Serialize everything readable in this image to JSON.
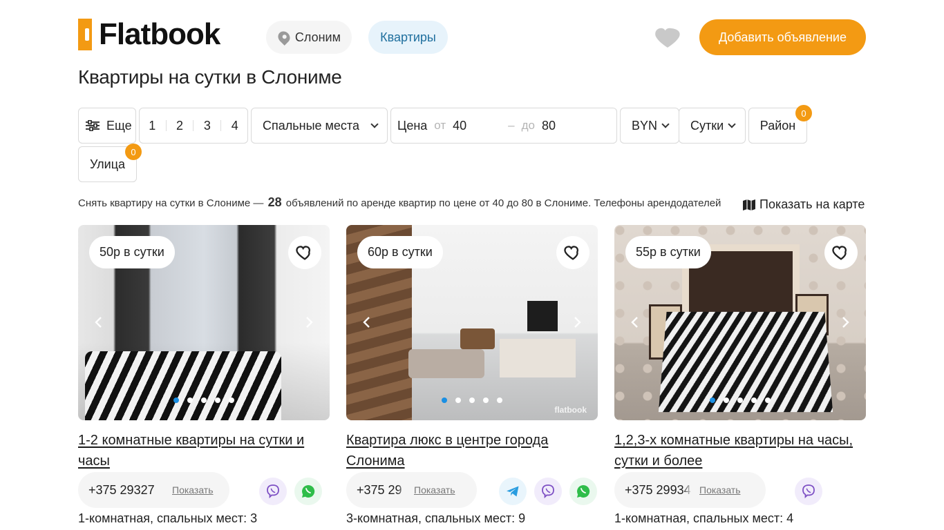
{
  "header": {
    "logo_text": "Flatbook",
    "city": "Слоним",
    "category": "Квартиры",
    "add_button": "Добавить объявление"
  },
  "page_title": "Квартиры на сутки в Слониме",
  "filters": {
    "more_label": "Еще",
    "rooms": [
      "1",
      "2",
      "3",
      "4"
    ],
    "beds_label": "Спальные места",
    "price_label": "Цена",
    "price_from_label": "от",
    "price_from_value": "40",
    "price_dash": "–",
    "price_to_label": "до",
    "price_to_value": "80",
    "currency": "BYN",
    "period": "Сутки",
    "district_label": "Район",
    "district_count": "0",
    "street_label": "Улица",
    "street_count": "0"
  },
  "summary": {
    "prefix": "Снять квартиру на сутки в Слониме —",
    "count": "28",
    "suffix": "объявлений по аренде квартир по цене от 40 до 80 в Слониме. Телефоны арендодателей"
  },
  "map_link": "Показать на карте",
  "listings": [
    {
      "price": "50р в сутки",
      "title": "1-2 комнатные квартиры на сутки и часы",
      "phone": "+375 29327",
      "show_label": "Показать",
      "description": "1-комнатная, спальных мест: 3",
      "messengers": [
        "viber-icon",
        "whatsapp-icon"
      ]
    },
    {
      "price": "60р в сутки",
      "title": "Квартира люкс в центре города Слонима",
      "phone": "+375 29",
      "show_label": "Показать",
      "description": "3-комнатная, спальных мест: 9",
      "watermark": "flatbook",
      "messengers": [
        "telegram-icon",
        "viber-icon",
        "whatsapp-icon"
      ]
    },
    {
      "price": "55р в сутки",
      "title": "1,2,3-х комнатные квартиры на часы, сутки и более",
      "phone": "+375 29934",
      "show_label": "Показать",
      "description": "1-комнатная, спальных мест: 4",
      "messengers": [
        "viber-icon"
      ]
    }
  ],
  "colors": {
    "accent": "#f39a13",
    "active_dot": "#1a8fe3",
    "category_chip_bg": "#e7f3fb"
  }
}
